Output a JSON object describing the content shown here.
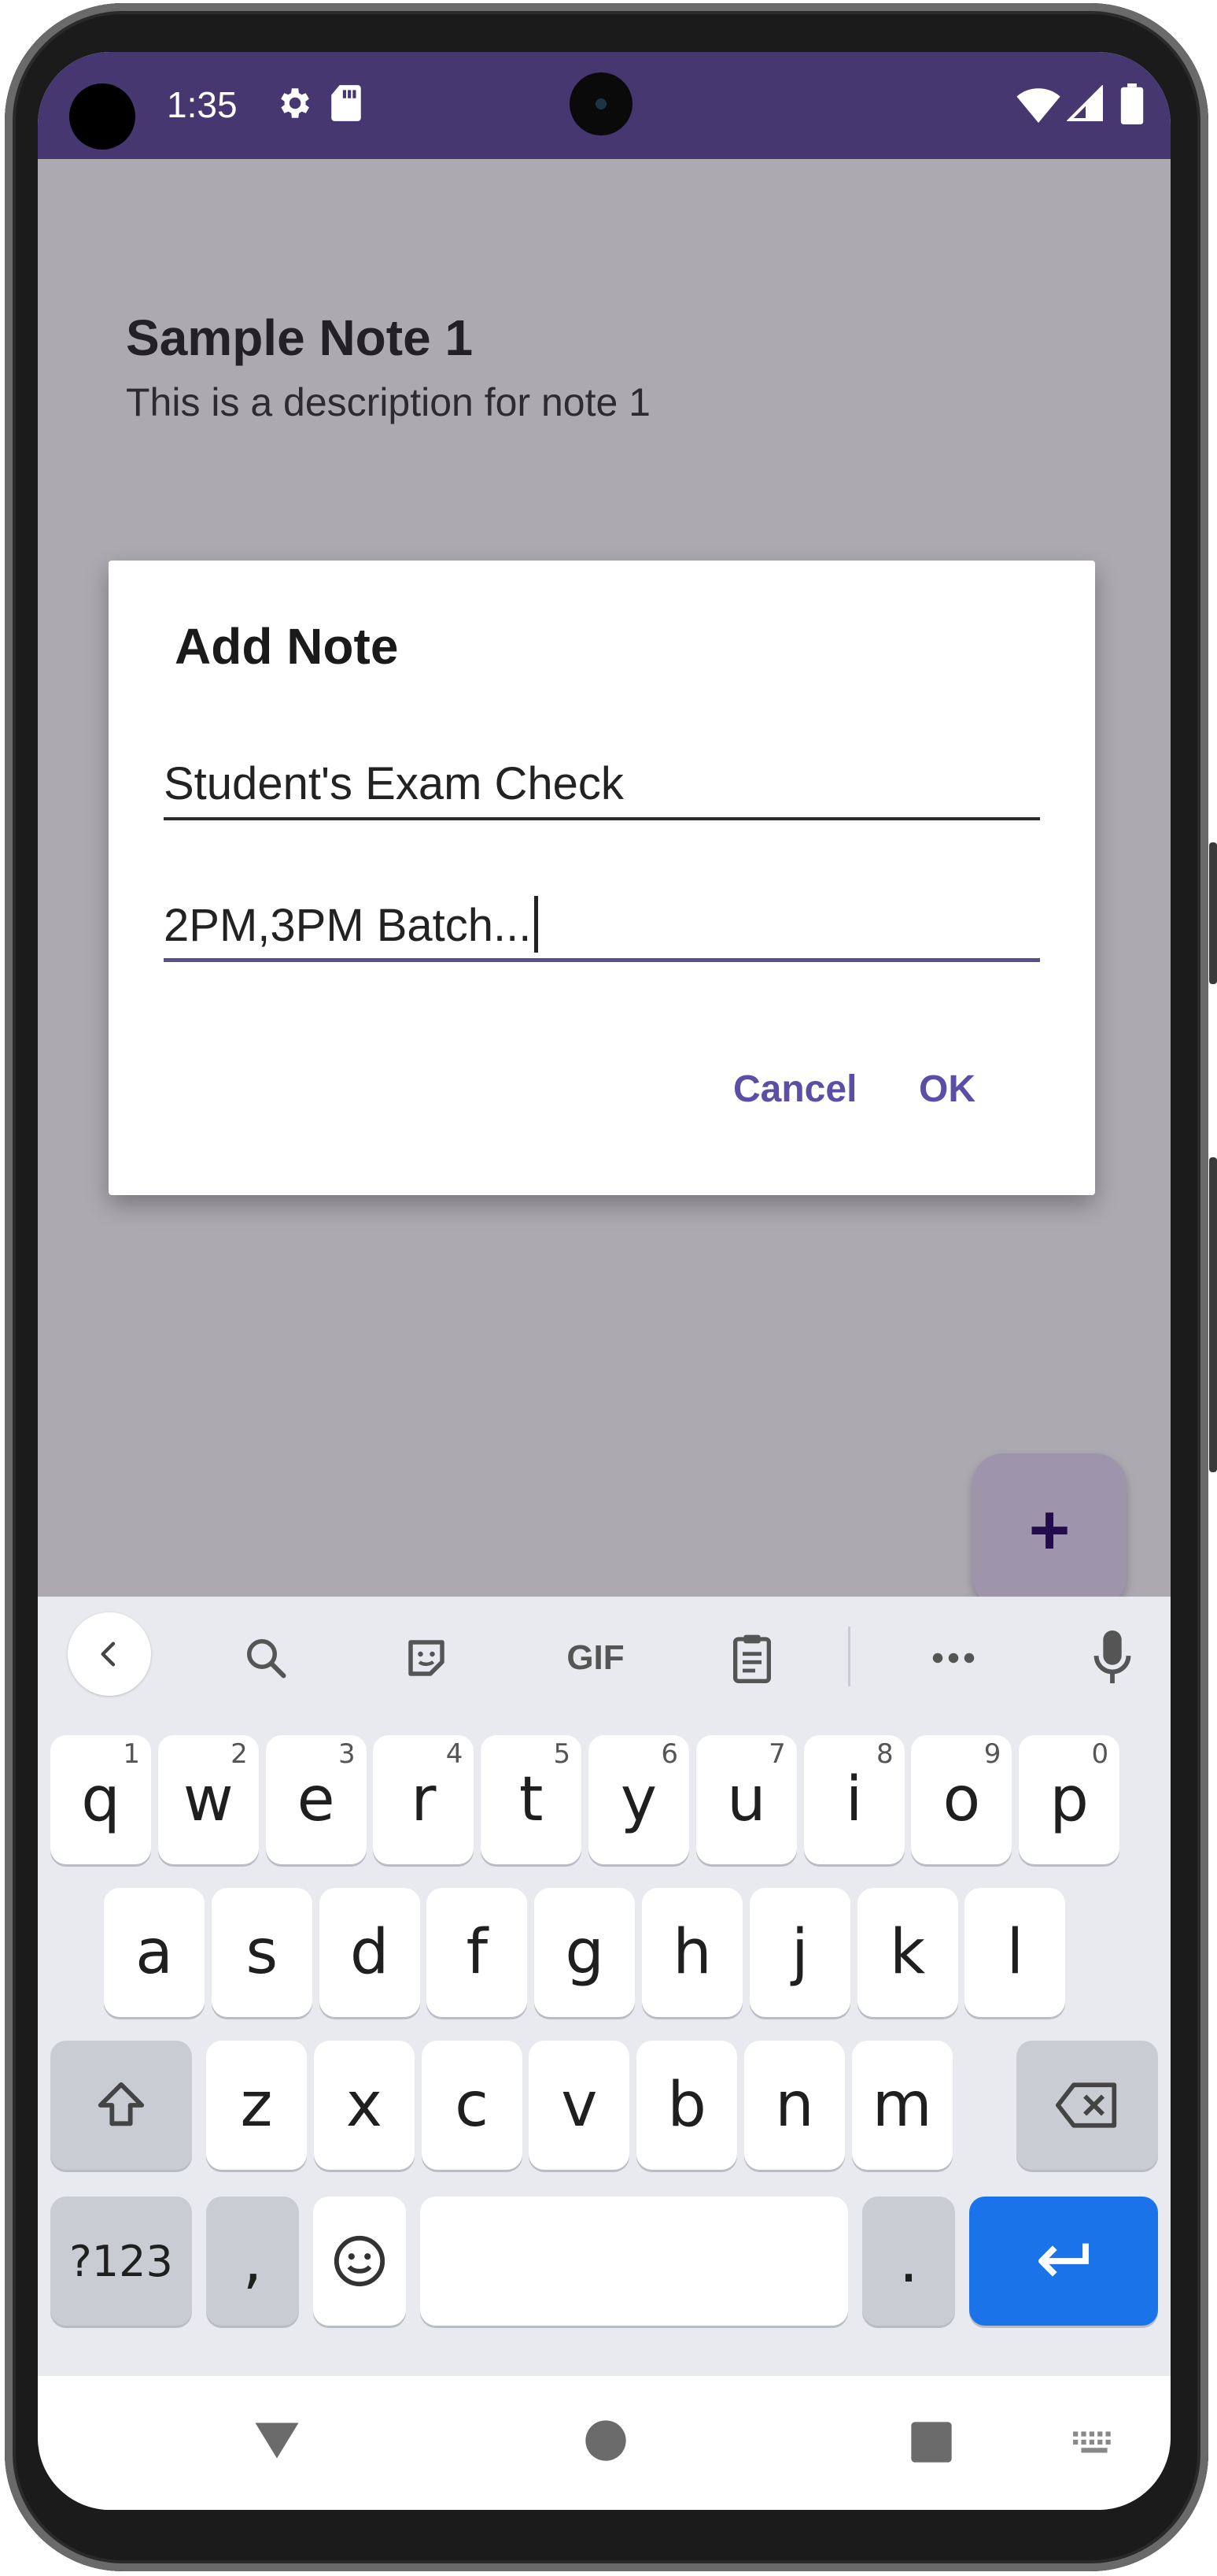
{
  "status_bar": {
    "time": "1:35",
    "icons": [
      "settings-icon",
      "sd-card-icon",
      "wifi-icon",
      "signal-icon",
      "battery-icon"
    ]
  },
  "notes": [
    {
      "title": "Sample Note 1",
      "description": "This is a description for note 1"
    }
  ],
  "fab": {
    "label": "+"
  },
  "dialog": {
    "title": "Add Note",
    "title_field_value": "Student's Exam Check",
    "description_field_value": "2PM,3PM Batch...",
    "cancel_label": "Cancel",
    "ok_label": "OK"
  },
  "keyboard": {
    "toolbar_icons": [
      "back-chevron-icon",
      "search-icon",
      "sticker-icon",
      "gif-icon",
      "clipboard-icon",
      "more-icon",
      "mic-icon"
    ],
    "gif_label": "GIF",
    "row1": [
      {
        "k": "q",
        "h": "1"
      },
      {
        "k": "w",
        "h": "2"
      },
      {
        "k": "e",
        "h": "3"
      },
      {
        "k": "r",
        "h": "4"
      },
      {
        "k": "t",
        "h": "5"
      },
      {
        "k": "y",
        "h": "6"
      },
      {
        "k": "u",
        "h": "7"
      },
      {
        "k": "i",
        "h": "8"
      },
      {
        "k": "o",
        "h": "9"
      },
      {
        "k": "p",
        "h": "0"
      }
    ],
    "row2": [
      "a",
      "s",
      "d",
      "f",
      "g",
      "h",
      "j",
      "k",
      "l"
    ],
    "row3": [
      "z",
      "x",
      "c",
      "v",
      "b",
      "n",
      "m"
    ],
    "symbols_label": "?123",
    "comma_label": ",",
    "period_label": "."
  },
  "colors": {
    "status_bar": "#463770",
    "accent": "#5b4ea6",
    "enter_key": "#1a73e8"
  }
}
